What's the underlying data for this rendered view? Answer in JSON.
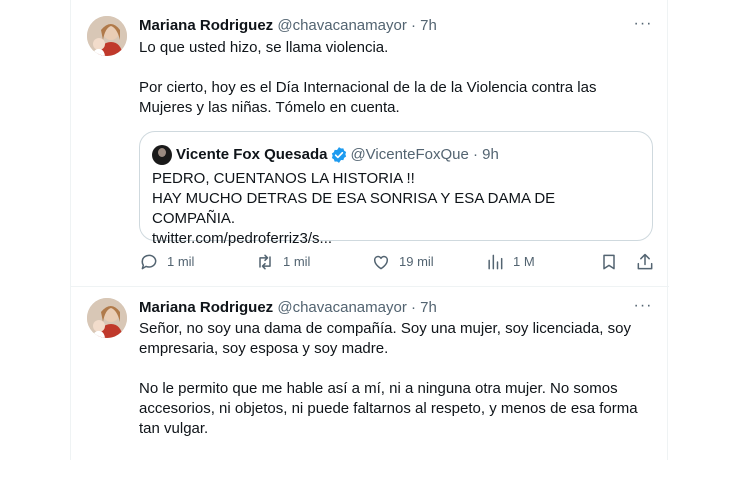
{
  "tweets": [
    {
      "author": {
        "name": "Mariana Rodriguez",
        "handle": "@chavacanamayor"
      },
      "separator": "·",
      "time": "7h",
      "more_label": "···",
      "paragraphs": [
        "Lo que usted hizo, se llama violencia.",
        "Por cierto, hoy es el Día Internacional de la de la Violencia contra las Mujeres y las niñas. Tómelo en cuenta."
      ],
      "quote": {
        "author": {
          "name": "Vicente Fox Quesada",
          "handle": "@VicenteFoxQue",
          "verified": true
        },
        "separator": "·",
        "time": "9h",
        "lines": [
          "PEDRO, CUENTANOS LA HISTORIA !!",
          "HAY MUCHO DETRAS DE ESA SONRISA Y ESA DAMA DE COMPAÑIA.",
          "twitter.com/pedroferriz3/s..."
        ]
      },
      "actions": {
        "replies": "1 mil",
        "retweets": "1 mil",
        "likes": "19 mil",
        "views": "1 M"
      }
    },
    {
      "author": {
        "name": "Mariana Rodriguez",
        "handle": "@chavacanamayor"
      },
      "separator": "·",
      "time": "7h",
      "more_label": "···",
      "paragraphs": [
        "Señor, no soy una dama de compañía. Soy una mujer, soy licenciada, soy empresaria, soy esposa y soy madre.",
        "No le permito que me hable así a mí, ni a ninguna otra mujer. No somos accesorios, ni objetos, ni puede faltarnos al respeto, y menos de esa forma tan vulgar."
      ]
    }
  ],
  "icons": {
    "reply": "reply-icon",
    "retweet": "retweet-icon",
    "like": "heart-icon",
    "views": "views-icon",
    "bookmark": "bookmark-icon",
    "share": "share-icon",
    "verified": "verified-badge-icon",
    "more": "more-icon"
  },
  "colors": {
    "text": "#0f1419",
    "secondary": "#536471",
    "border": "#cfd9de",
    "divider": "#eff3f4",
    "verified": "#1d9bf0"
  }
}
